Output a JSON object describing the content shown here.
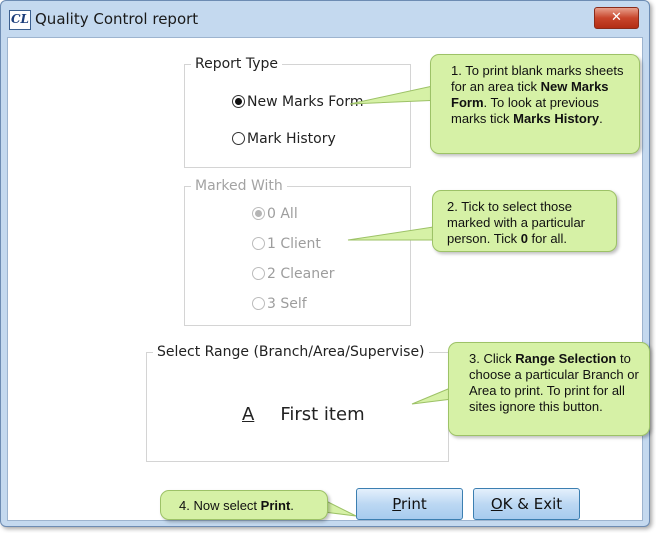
{
  "window": {
    "title": "Quality Control report",
    "icon_text": "CL",
    "close_label": "✕"
  },
  "report_type": {
    "legend": "Report Type",
    "options": [
      {
        "label": "New Marks Form",
        "checked": true
      },
      {
        "label": "Mark History",
        "checked": false
      }
    ]
  },
  "marked_with": {
    "legend": "Marked With",
    "options": [
      {
        "label": "0  All",
        "checked": true
      },
      {
        "label": "1  Client",
        "checked": false
      },
      {
        "label": "2  Cleaner",
        "checked": false
      },
      {
        "label": "3  Self",
        "checked": false
      }
    ]
  },
  "select_range": {
    "legend": "Select Range (Branch/Area/Supervise)",
    "letter": "A",
    "item": "First item"
  },
  "buttons": {
    "print_accel": "P",
    "print_rest": "rint",
    "ok_accel": "O",
    "ok_rest": "K & Exit"
  },
  "callouts": {
    "c1": {
      "a": "1. To print blank marks sheets for an area tick ",
      "b1": "New Marks Form",
      "c": ". To look at previous marks tick ",
      "b2": "Marks History",
      "d": "."
    },
    "c2": {
      "a": "2. Tick to select those marked with a particular person. Tick ",
      "b1": "0",
      "c": " for all."
    },
    "c3": {
      "a": "3. Click ",
      "b1": "Range Selection",
      "c": " to choose a particular Branch or Area to print. To print for all sites ignore this button."
    },
    "c4": {
      "a": "4. Now select ",
      "b1": "Print",
      "c": "."
    }
  },
  "colors": {
    "callout_fill": "#d6f1a6",
    "callout_border": "#9dc267",
    "button_fill": "#bcd8f3",
    "close_fill": "#c8452b"
  }
}
